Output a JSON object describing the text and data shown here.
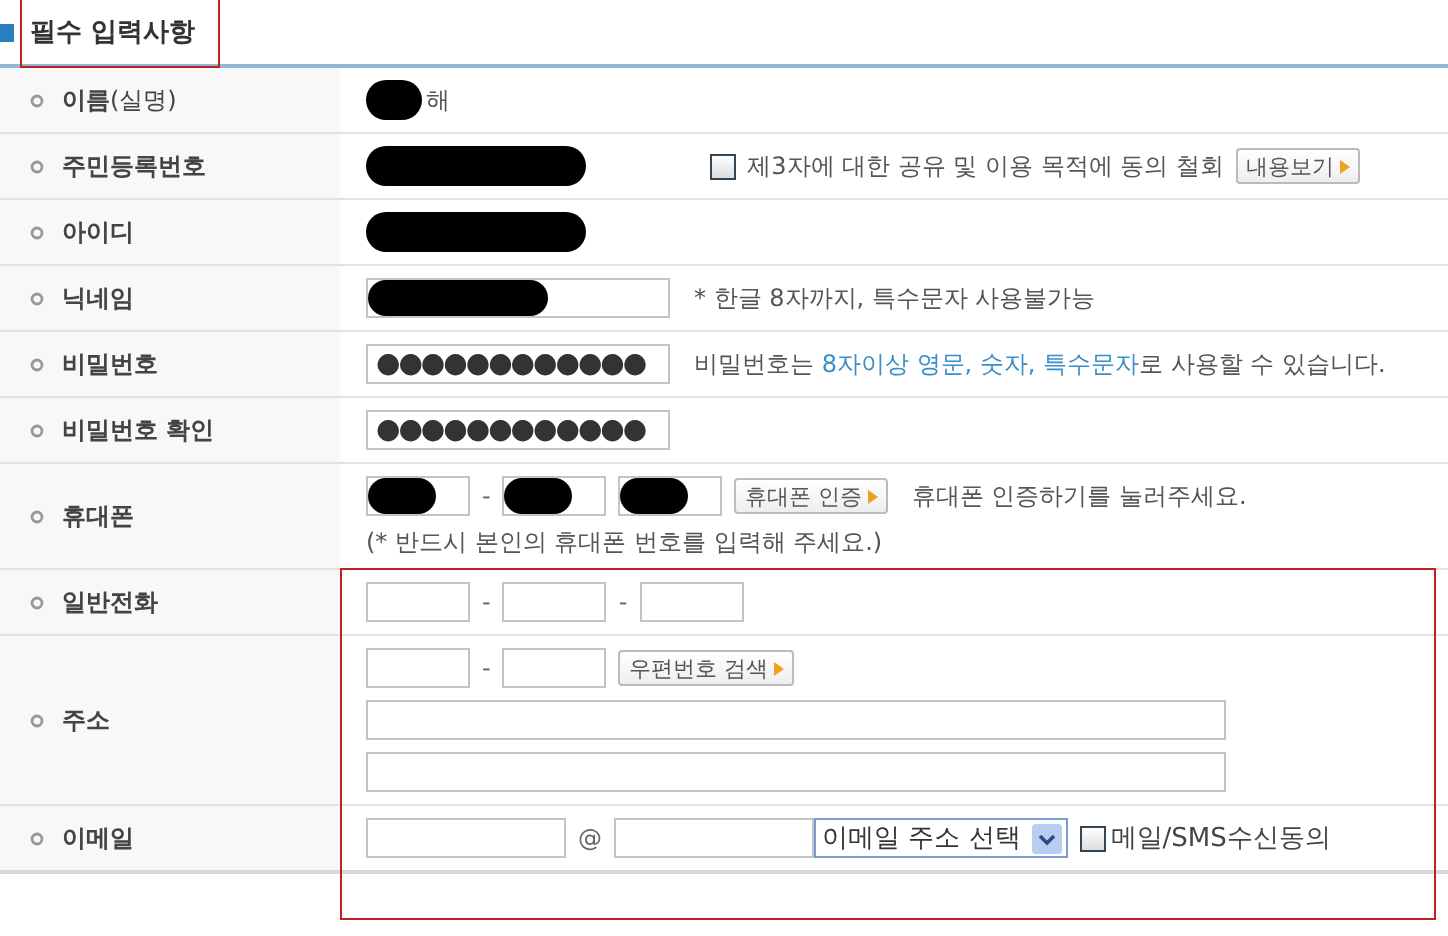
{
  "section": {
    "title": "필수 입력사항"
  },
  "rows": [
    {
      "label": "**이름**(실명)",
      "lines": [
        [
          {
            "kind": "redaction"
          },
          {
            "kind": "text",
            "text": "해"
          }
        ]
      ]
    },
    {
      "label": "주민등록번호",
      "lines": [
        [
          {
            "kind": "redaction-wide"
          },
          {
            "kind": "checkbox",
            "text": "제3자에 대한 공유 및 이용 목적에 동의 철회",
            "checked": false
          },
          {
            "kind": "button",
            "text": "내용보기"
          }
        ]
      ]
    },
    {
      "label": "아이디",
      "lines": [
        [
          {
            "kind": "redaction-wide"
          }
        ]
      ]
    },
    {
      "label": "닉네임",
      "lines": [
        [
          {
            "kind": "input",
            "redacted": true
          },
          {
            "kind": "hint",
            "parts": [
              {
                "text": "* 한글 8자까지, 특수문자 사용불가능",
                "highlight": false
              }
            ]
          }
        ]
      ]
    },
    {
      "label": "비밀번호",
      "lines": [
        [
          {
            "kind": "input",
            "value": "●●●●●●●●●●●●"
          },
          {
            "kind": "hint",
            "parts": [
              {
                "text": "비밀번호는 ",
                "highlight": false
              },
              {
                "text": "8자이상 영문, 숫자, 특수문자",
                "highlight": true
              },
              {
                "text": "로 사용할 수 있습니다.",
                "highlight": false
              }
            ]
          }
        ]
      ]
    },
    {
      "label": "비밀번호 확인",
      "lines": [
        [
          {
            "kind": "input",
            "value": "●●●●●●●●●●●●"
          }
        ]
      ]
    },
    {
      "label": "휴대폰",
      "lines": [
        [
          {
            "kind": "short-input",
            "redacted": true
          },
          {
            "kind": "separator",
            "text": "-"
          },
          {
            "kind": "short-input",
            "redacted": true
          },
          {
            "kind": "short-input",
            "redacted": true
          },
          {
            "kind": "button",
            "text": "휴대폰 인증"
          },
          {
            "kind": "hint",
            "parts": [
              {
                "text": "휴대폰 인증하기를 눌러주세요.",
                "highlight": false
              }
            ]
          }
        ],
        [
          {
            "kind": "hint",
            "parts": [
              {
                "text": "(* 반드시 본인의 휴대폰 번호를 입력해 주세요.)",
                "highlight": false
              }
            ]
          }
        ]
      ]
    },
    {
      "label": "일반전화",
      "lines": [
        [
          {
            "kind": "short-input"
          },
          {
            "kind": "separator",
            "text": "-"
          },
          {
            "kind": "short-input"
          },
          {
            "kind": "separator",
            "text": "-"
          },
          {
            "kind": "short-input"
          }
        ]
      ]
    },
    {
      "label": "주소",
      "lines": [
        [
          {
            "kind": "short-input"
          },
          {
            "kind": "separator",
            "text": "-"
          },
          {
            "kind": "short-input"
          },
          {
            "kind": "button",
            "text": "우편번호 검색"
          }
        ],
        [
          {
            "kind": "long-input"
          }
        ],
        [
          {
            "kind": "long-input"
          }
        ]
      ]
    },
    {
      "label": "이메일",
      "lines": [
        [
          {
            "kind": "email-input"
          },
          {
            "kind": "separator",
            "text": "@"
          },
          {
            "kind": "email-input"
          },
          {
            "kind": "select",
            "text": "이메일 주소 선택"
          },
          {
            "kind": "checkbox",
            "text": "메일/SMS수신동의",
            "checked": false
          }
        ]
      ]
    }
  ]
}
